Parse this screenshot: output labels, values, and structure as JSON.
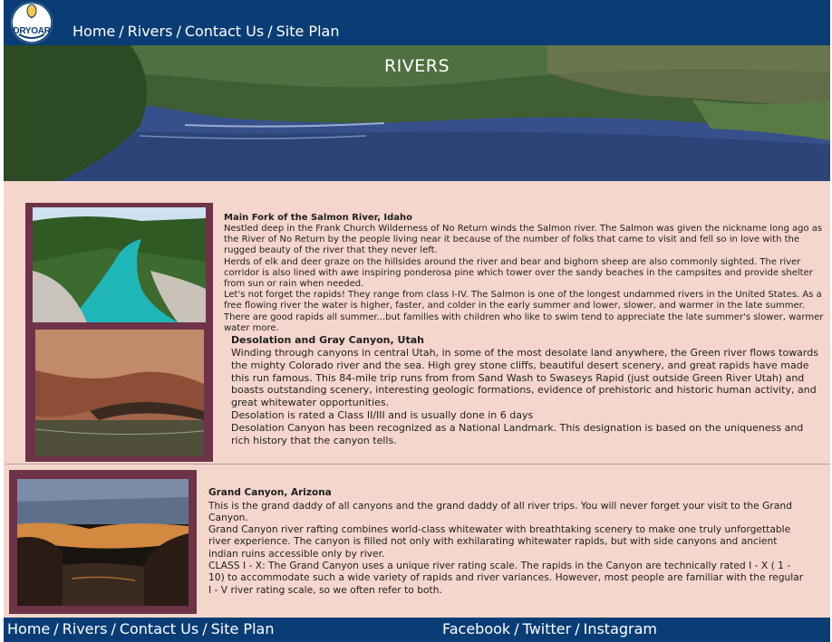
{
  "header": {
    "logo_text": "DRYOAR",
    "nav": [
      "Home",
      "Rivers",
      "Contact Us",
      "Site Plan"
    ]
  },
  "hero": {
    "title": "RIVERS"
  },
  "articles": [
    {
      "title": "Main Fork of the Salmon River, Idaho",
      "paragraphs": [
        "Nestled deep in the Frank Church Wilderness of No Return winds the Salmon river. The Salmon was given the nickname long ago as the River of No Return by the people living near it because of the number of folks that came to visit and fell so in love with the rugged beauty of the river that they never left.",
        "Herds of elk and deer graze on the hillsides around the river and bear and bighorn sheep are also commonly sighted. The river corridor is also lined with awe inspiring ponderosa pine which tower over the sandy beaches in the campsites and provide shelter from sun or rain when needed.",
        "Let's not forget the rapids! They range from class I-IV. The Salmon is one of the longest undammed rivers in the United States. As a free flowing river the water is higher, faster, and colder in the early summer and lower, slower, and warmer in the late summer. There are good rapids all summer...but families with children who like to swim tend to appreciate the late summer's slower, warmer water more."
      ]
    },
    {
      "title": "Desolation and Gray Canyon, Utah",
      "paragraphs": [
        "Winding through canyons in central Utah, in some of the most desolate land anywhere, the Green river flows towards the mighty Colorado river and the sea. High grey stone cliffs, beautiful desert scenery, and great rapids have made this run famous. This 84-mile trip runs from from Sand Wash to Swaseys Rapid (just outside Green River Utah) and boasts outstanding scenery, interesting geologic formations, evidence of prehistoric and historic human activity, and great whitewater opportunities.",
        "Desolation is rated a Class II/III and is usually done in 6 days",
        "Desolation Canyon has been recognized as a National Landmark.  This designation is based on the uniqueness and rich history that the canyon tells."
      ]
    },
    {
      "title": "Grand Canyon, Arizona",
      "paragraphs": [
        "This is the grand daddy of all canyons and the grand daddy of all river trips. You will never forget your visit to the Grand Canyon.",
        "Grand Canyon river rafting combines world-class whitewater with breathtaking scenery to make one truly unforgettable river experience. The canyon is filled not only with exhilarating whitewater rapids, but with side canyons and ancient indian ruins accessible only by river.",
        "CLASS I - X: The Grand Canyon uses a unique river rating scale. The rapids in the Canyon are technically rated I - X ( 1 - 10) to accommodate such a wide variety of rapids and river variances. However, most people are familiar with the regular I - V river rating scale, so we often refer to both."
      ]
    }
  ],
  "footer": {
    "nav": [
      "Home",
      "Rivers",
      "Contact Us",
      "Site Plan"
    ],
    "social": [
      "Facebook",
      "Twitter",
      "Instagram"
    ]
  }
}
